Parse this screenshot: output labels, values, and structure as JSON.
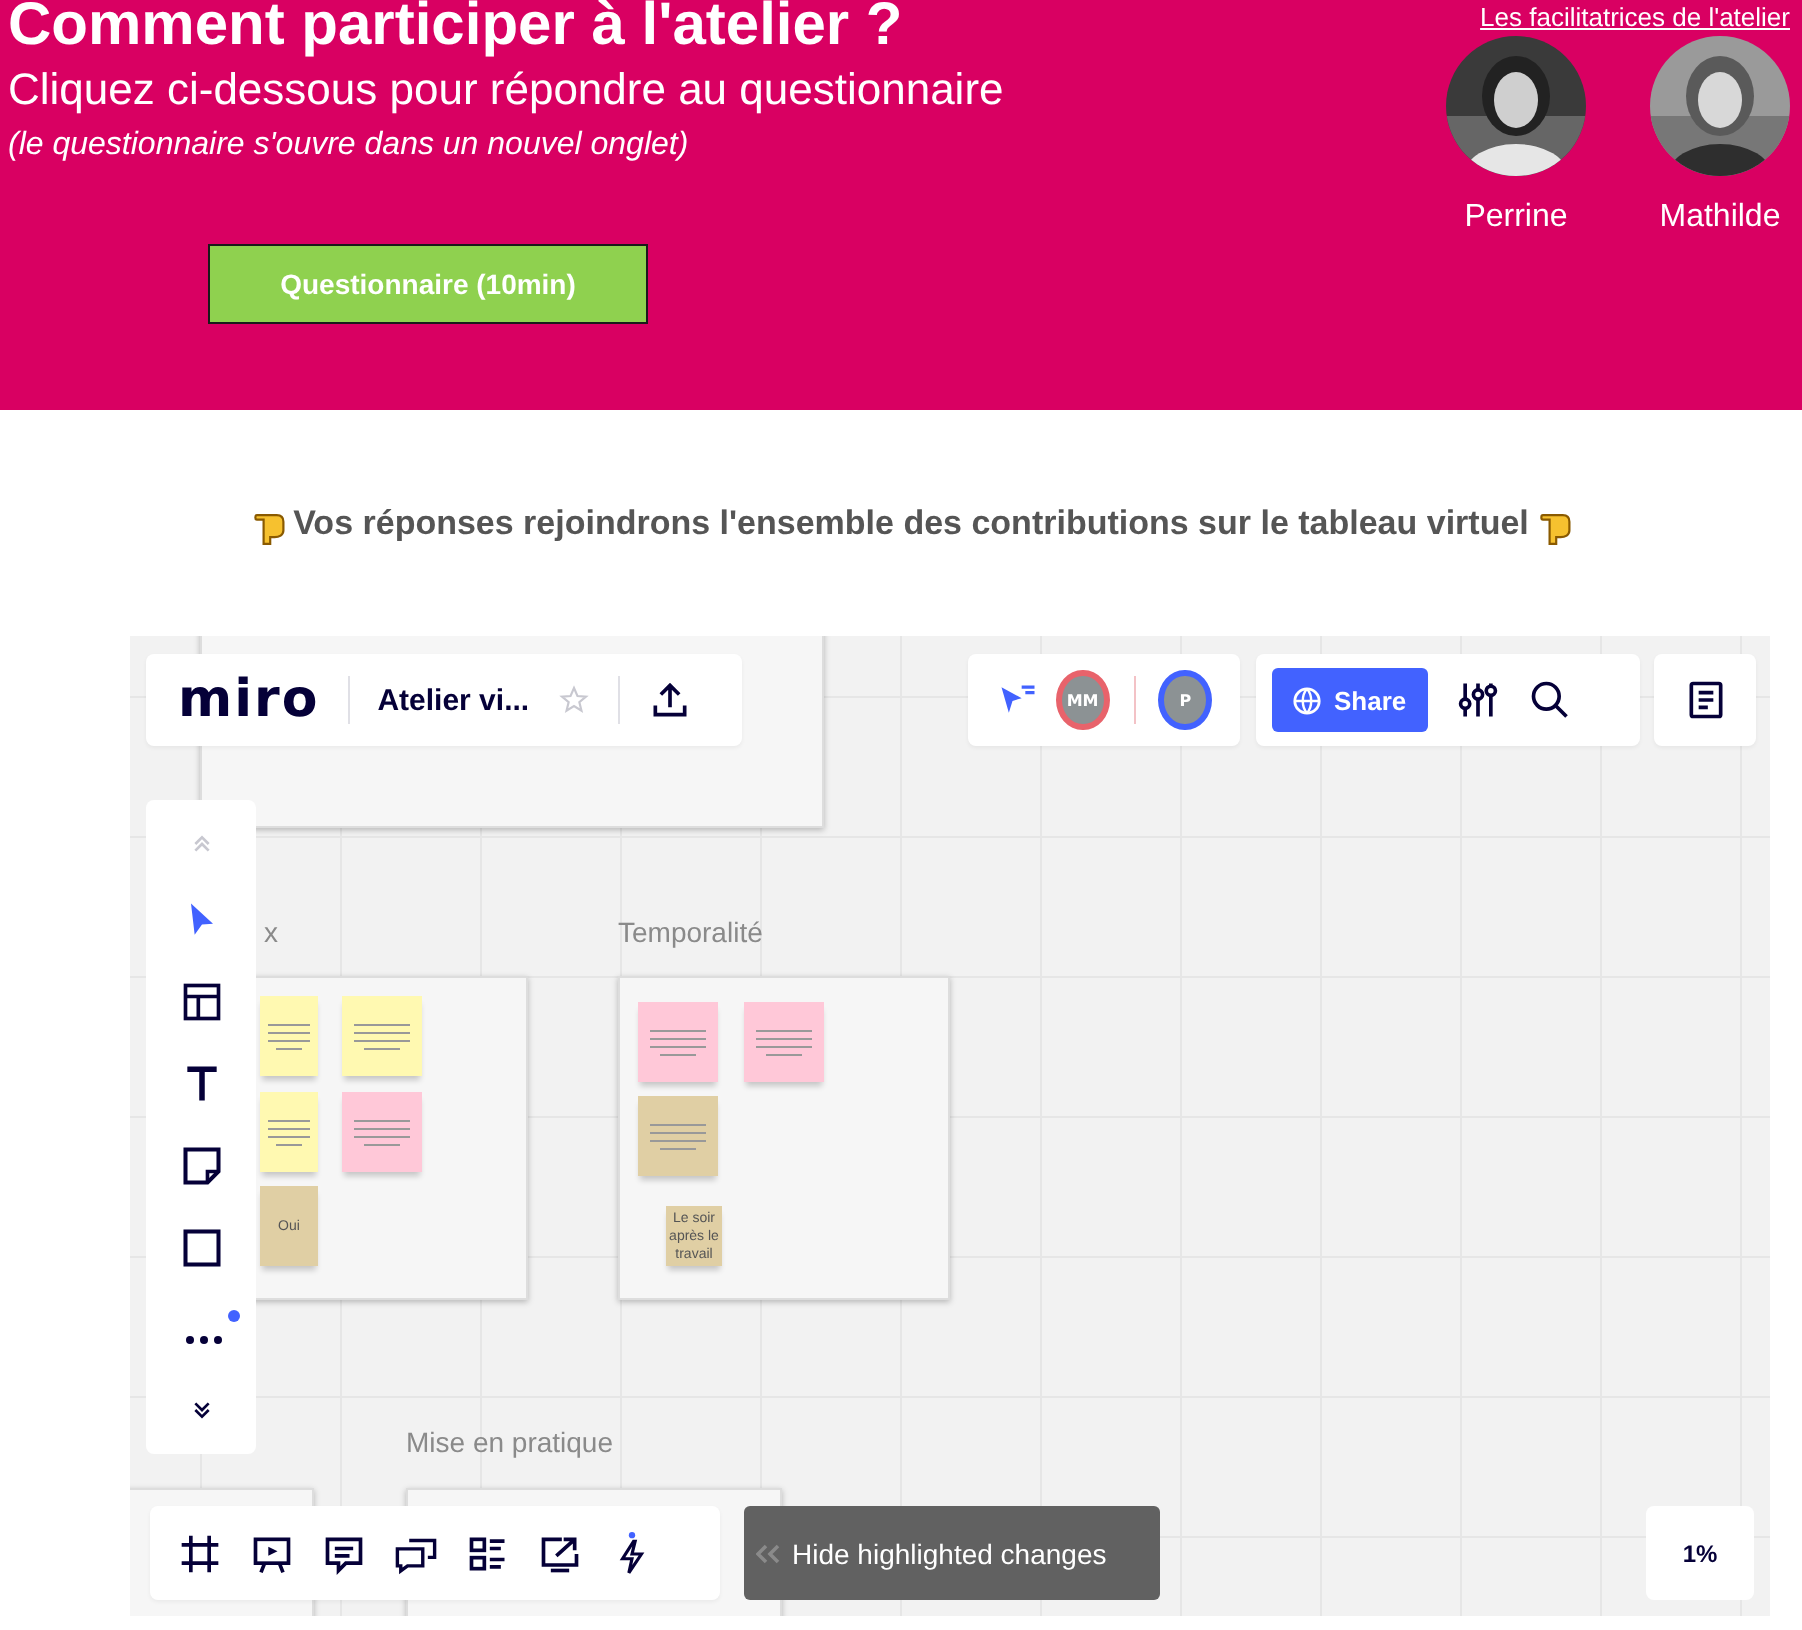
{
  "header": {
    "title": "Comment participer à l'atelier ?",
    "subtitle": "Cliquez ci-dessous pour répondre au questionnaire",
    "note": "(le questionnaire s'ouvre dans un nouvel onglet)",
    "button": "Questionnaire (10min)",
    "facilitators_link": "Les facilitatrices de l'atelier",
    "facilitators": [
      {
        "name": "Perrine",
        "kind": "picture"
      },
      {
        "name": "Mathilde",
        "kind": "picture"
      }
    ]
  },
  "intro": "Vos réponses rejoindrons l'ensemble des contributions sur le tableau virtuel",
  "board": {
    "logo": "miro",
    "board_title": "Atelier vi...",
    "share": "Share",
    "banner": "Hide highlighted changes",
    "zoom": "1%",
    "collaborators": [
      {
        "initials": "MM",
        "color": "#e8636b"
      },
      {
        "initials": "P",
        "color": "#4262ff"
      }
    ],
    "tools": [
      {
        "kind": "select",
        "selected": true
      },
      {
        "kind": "template",
        "selected": false
      },
      {
        "kind": "text",
        "selected": false
      },
      {
        "kind": "sticky",
        "selected": false
      },
      {
        "kind": "shape",
        "selected": false
      },
      {
        "kind": "more",
        "selected": false
      }
    ],
    "frames": [
      {
        "label": "x",
        "notes": [
          {
            "color": "#fff9b1"
          },
          {
            "color": "#fff9b1"
          },
          {
            "color": "#fff9b1"
          },
          {
            "color": "#ffc8d8"
          },
          {
            "color": "#e0cfa4",
            "text": "Oui"
          }
        ]
      },
      {
        "label": "Temporalité",
        "notes": [
          {
            "color": "#ffc8d8"
          },
          {
            "color": "#ffc8d8"
          },
          {
            "color": "#e0cfa4"
          },
          {
            "color": "#e0cfa4",
            "text": "Le soir après le travail"
          }
        ]
      },
      {
        "label": "Mise en pratique"
      }
    ]
  }
}
